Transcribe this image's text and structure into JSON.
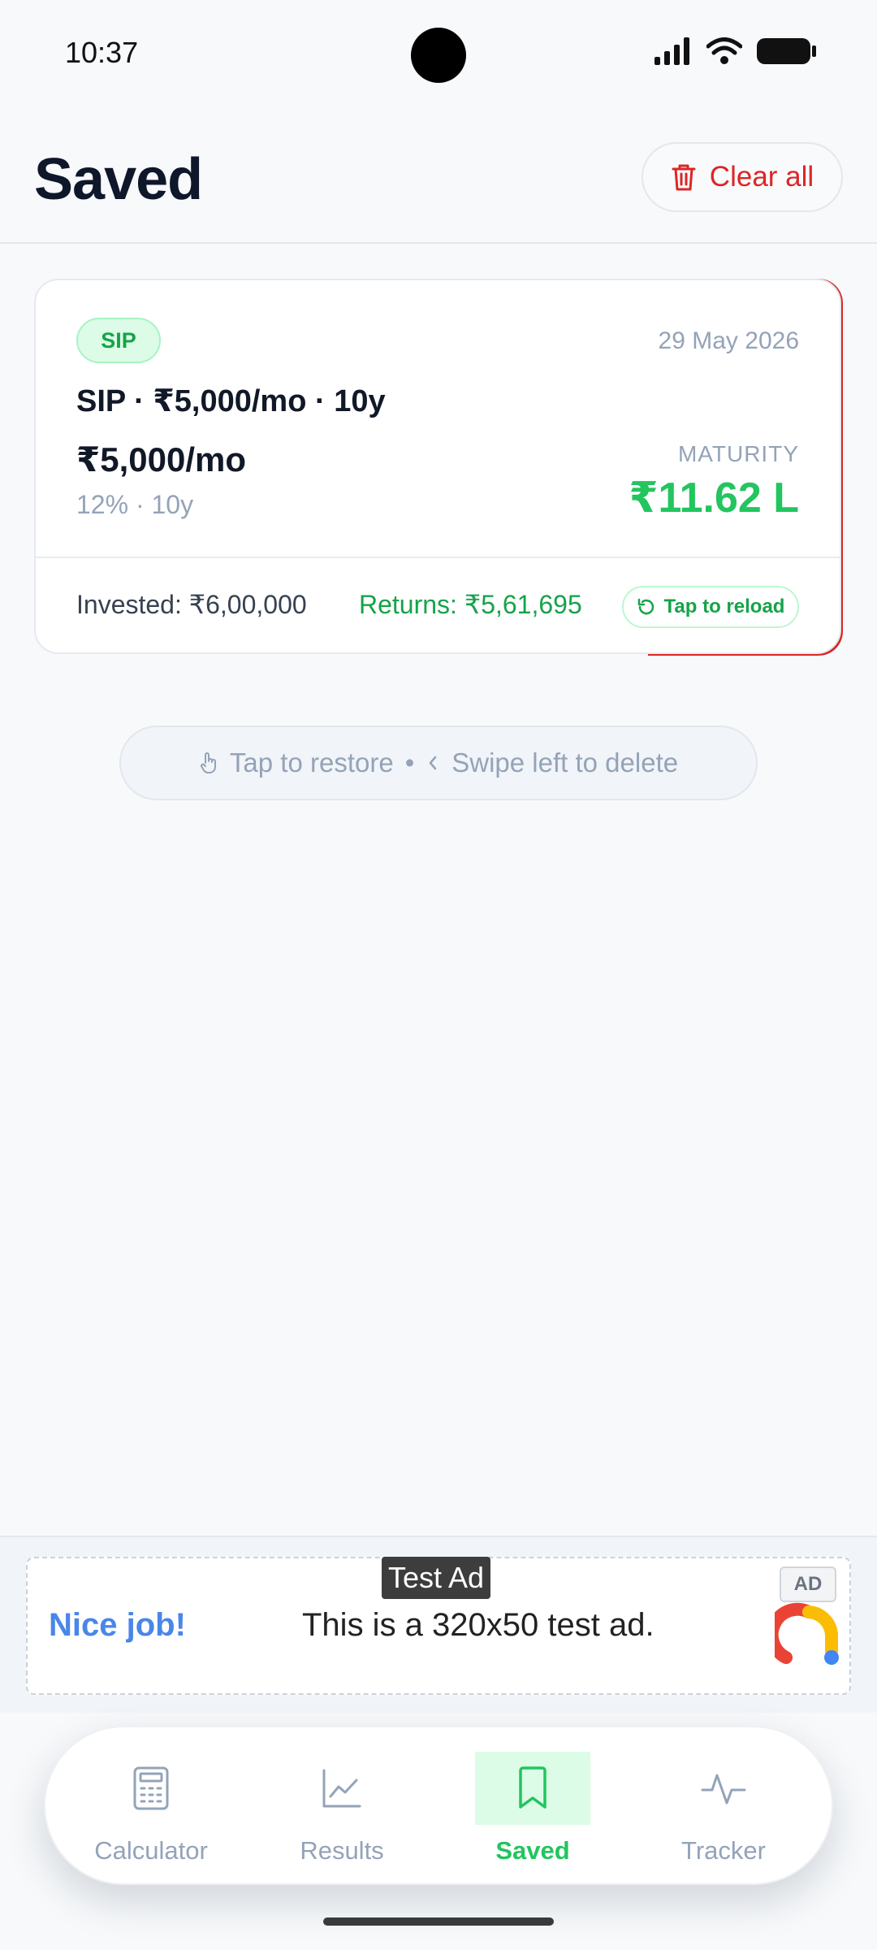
{
  "status_bar": {
    "time": "10:37"
  },
  "header": {
    "title": "Saved",
    "clear_label": "Clear all"
  },
  "saved_items": [
    {
      "type_badge": "SIP",
      "date": "29 May 2026",
      "title": "SIP · ₹5,000/mo · 10y",
      "amount": "₹5,000/mo",
      "subtitle": "12% · 10y",
      "maturity_label": "MATURITY",
      "maturity_value": "₹11.62 L",
      "invested": "Invested: ₹6,00,000",
      "returns": "Returns: ₹5,61,695",
      "reload_label": "Tap to reload"
    }
  ],
  "hint": {
    "restore": "Tap to restore",
    "separator": "•",
    "delete": "Swipe left to delete"
  },
  "ad": {
    "label": "Test Ad",
    "headline": "Nice job!",
    "text": "This is a 320x50 test ad.",
    "badge": "AD"
  },
  "bottom_nav": {
    "items": [
      {
        "label": "Calculator",
        "icon": "calculator-icon",
        "active": false
      },
      {
        "label": "Results",
        "icon": "chart-line-icon",
        "active": false
      },
      {
        "label": "Saved",
        "icon": "bookmark-icon",
        "active": true
      },
      {
        "label": "Tracker",
        "icon": "activity-icon",
        "active": false
      }
    ]
  },
  "colors": {
    "accent_green": "#22c55e",
    "danger_red": "#dc2626",
    "muted": "#94a3b8"
  }
}
